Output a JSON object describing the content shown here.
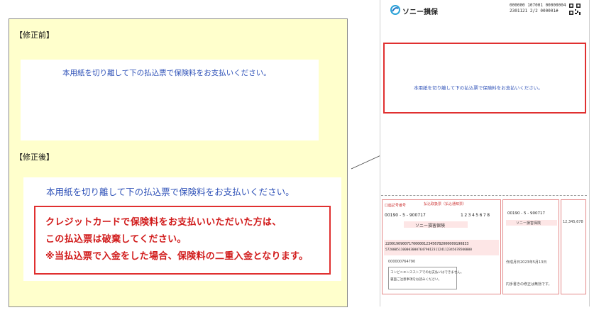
{
  "left_panel": {
    "before_heading": "【修正前】",
    "after_heading": "【修正後】",
    "before_notice": "本用紙を切り離して下の払込票で保険料をお支払いください。",
    "after_notice": "本用紙を切り離して下の払込票で保険料をお支払いください。",
    "warning_lines": [
      "クレジットカードで保険料をお支払いいただいた方は、",
      "この払込票は破棄してください。",
      "※当払込票で入金をした場合、保険料の二重入金となります。"
    ]
  },
  "document": {
    "logo": "ソニー損保",
    "code_line1": "000000 107001 00000004",
    "code_line2": "2301121 2/2 000001#",
    "highlight_text": "本用紙を切り離して下の払込票で保険料をお支払いください。",
    "slip": {
      "title": "払込取扱票（払込通知票）",
      "account_label": "口座記号番号",
      "account_number": "00190 - 5 - 900717",
      "amount": "12345678",
      "payee": "ソニー損害保険",
      "ocr_line1": "220019090071700000123456782000009190833",
      "ocr_line2": "572000511000030007647901231124112345678500000",
      "customer_no": "000000764790",
      "due_label": "作成月日",
      "due_date": "2023年5月13日",
      "amount_display": "12,345,678",
      "branch_label": "ソニー損害保険",
      "receipt_note": "円手書きの修正は無効です。",
      "note1": "コンビニエンスストアでのお支払いはできません。",
      "note2": "裏面ご注意事項をお読みください。"
    }
  },
  "colors": {
    "panel_bg": "#ffffcc",
    "accent_red": "#e03030",
    "notice_blue": "#2f52b8"
  }
}
